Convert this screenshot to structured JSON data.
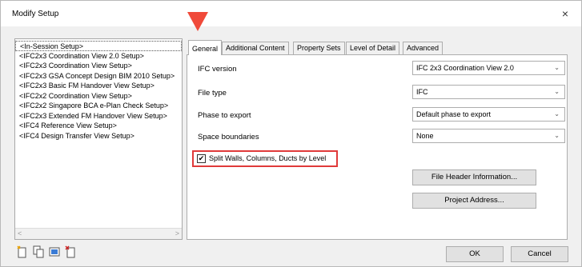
{
  "window": {
    "title": "Modify Setup",
    "close": "×"
  },
  "setups": [
    "<In-Session Setup>",
    "<IFC2x3 Coordination View 2.0 Setup>",
    "<IFC2x3 Coordination View Setup>",
    "<IFC2x3 GSA Concept Design BIM 2010 Setup>",
    "<IFC2x3 Basic FM Handover View Setup>",
    "<IFC2x2 Coordination View Setup>",
    "<IFC2x2 Singapore BCA e-Plan Check Setup>",
    "<IFC2x3 Extended FM Handover View Setup>",
    "<IFC4 Reference View Setup>",
    "<IFC4 Design Transfer View Setup>"
  ],
  "scroll": {
    "left": "<",
    "right": ">"
  },
  "tabs": [
    "General",
    "Additional Content",
    "Property Sets",
    "Level of Detail",
    "Advanced"
  ],
  "general": {
    "ifc_version_label": "IFC version",
    "ifc_version_value": "IFC 2x3 Coordination View 2.0",
    "file_type_label": "File type",
    "file_type_value": "IFC",
    "phase_label": "Phase to export",
    "phase_value": "Default phase to export",
    "space_label": "Space boundaries",
    "space_value": "None",
    "split_label": "Split Walls, Columns, Ducts by Level",
    "split_checked": "✔",
    "file_header_button": "File Header Information...",
    "project_address_button": "Project Address..."
  },
  "chev": "⌄",
  "buttons": {
    "ok": "OK",
    "cancel": "Cancel"
  },
  "colors": {
    "highlight": "#e03a3a",
    "arrow": "#f04a3a"
  }
}
